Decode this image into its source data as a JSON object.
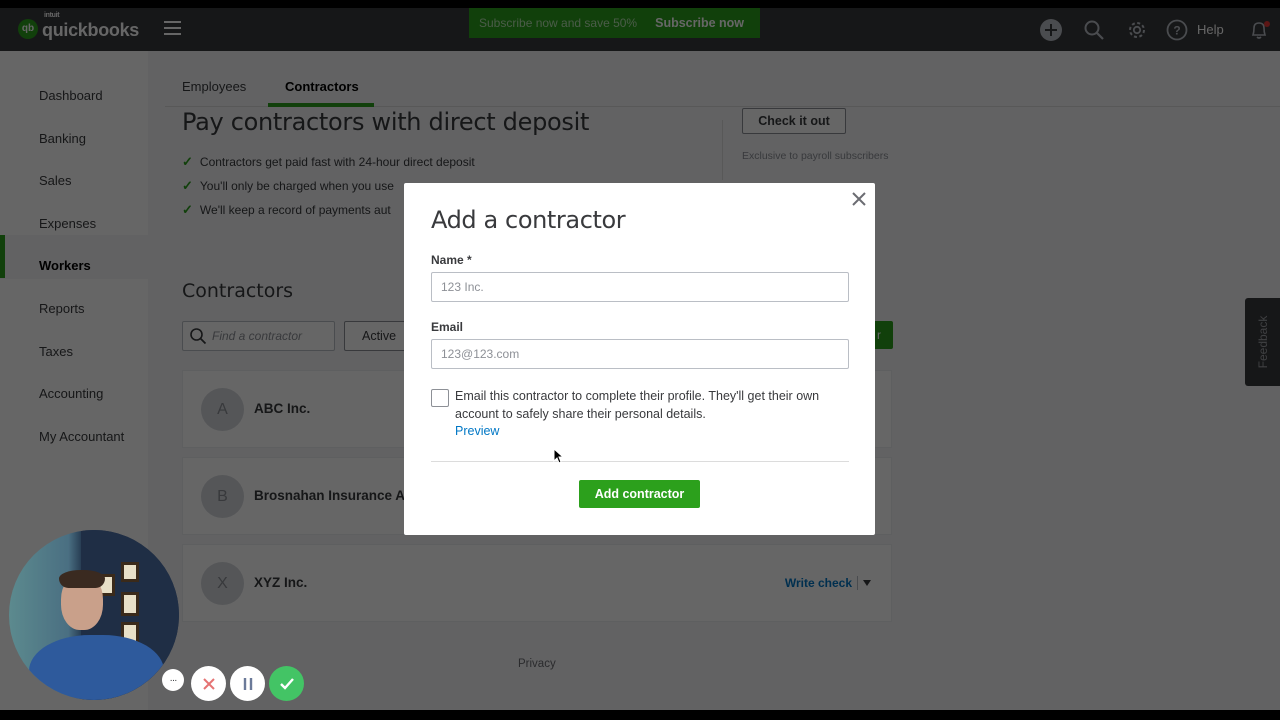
{
  "app": {
    "brand": "quickbooks",
    "brand_prefix": "intuit",
    "logo_mark": "qb"
  },
  "topbar": {
    "promo_text": "Subscribe now and save 50%",
    "promo_cta": "Subscribe now",
    "help_label": "Help",
    "icons": [
      "plus-icon",
      "search-icon",
      "gear-icon",
      "help-icon",
      "bell-icon"
    ]
  },
  "sidebar": {
    "items": [
      {
        "label": "Dashboard",
        "active": false
      },
      {
        "label": "Banking",
        "active": false
      },
      {
        "label": "Sales",
        "active": false
      },
      {
        "label": "Expenses",
        "active": false
      },
      {
        "label": "Workers",
        "active": true
      },
      {
        "label": "Reports",
        "active": false
      },
      {
        "label": "Taxes",
        "active": false
      },
      {
        "label": "Accounting",
        "active": false
      },
      {
        "label": "My Accountant",
        "active": false
      }
    ]
  },
  "tabs": [
    {
      "label": "Employees",
      "active": false
    },
    {
      "label": "Contractors",
      "active": true
    }
  ],
  "promo_panel": {
    "title": "Pay contractors with direct deposit",
    "bullets": [
      "Contractors get paid fast with 24-hour direct deposit",
      "You'll only be charged when you use",
      "We'll keep a record of payments aut"
    ],
    "cta": "Check it out",
    "note": "Exclusive to payroll subscribers"
  },
  "contractors": {
    "title": "Contractors",
    "search_placeholder": "Find a contractor",
    "filter_value": "Active",
    "add_button_partial": "r",
    "rows": [
      {
        "initial": "A",
        "name": "ABC Inc.",
        "action": ""
      },
      {
        "initial": "B",
        "name": "Brosnahan Insurance A",
        "action": ""
      },
      {
        "initial": "X",
        "name": "XYZ Inc.",
        "action": "Write check"
      }
    ]
  },
  "footer": {
    "privacy": "Privacy"
  },
  "feedback": {
    "label": "Feedback"
  },
  "modal": {
    "title": "Add a contractor",
    "name_label": "Name *",
    "name_value": "123 Inc.",
    "email_label": "Email",
    "email_value": "123@123.com",
    "checkbox_checked": false,
    "checkbox_text": "Email this contractor to complete their profile. They'll get their own account to safely share their personal details.",
    "preview_link": "Preview",
    "submit_label": "Add contractor"
  },
  "recorder": {
    "controls": [
      "more-icon",
      "cancel-icon",
      "pause-icon",
      "confirm-icon"
    ],
    "more_glyph": "···"
  }
}
